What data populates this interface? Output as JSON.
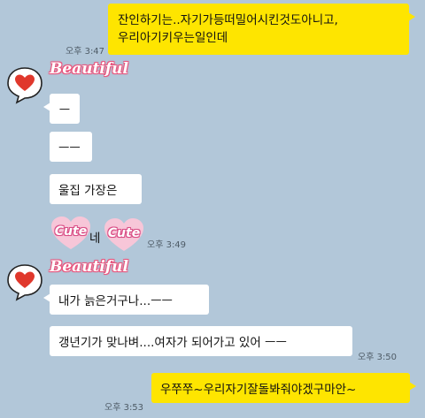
{
  "messages": {
    "m1_line1": "잔인하기는..자기가등떠밀어시킨것도아니고,",
    "m1_line2": "우리아기키우는일인데",
    "m1_time": "오후 3:47",
    "sticker1_text": "Beautiful",
    "m2": "ㅡ",
    "m3": "ㅡㅡ",
    "m4": "울집 가장은",
    "m5_text": "네",
    "m5_cute_left": "Cute",
    "m5_cute_right": "Cute",
    "m5_time": "오후 3:49",
    "sticker2_text": "Beautiful",
    "m6": "내가 늙은거구나...ㅡㅡ",
    "m7": "갱년기가 맞나벼....여자가 되어가고 있어 ㅡㅡ",
    "m7_time": "오후 3:50",
    "m8": "우쭈쭈~우리자기잘돌봐줘야겠구마안~",
    "m8_time": "오후 3:53"
  },
  "colors": {
    "background": "#b2c7d9",
    "my_bubble": "#fee500",
    "their_bubble": "#ffffff",
    "heart": "#e0382c",
    "sticker_pink": "#e9577f"
  },
  "icons": {
    "profile": "heart-speech-bubble-icon"
  }
}
